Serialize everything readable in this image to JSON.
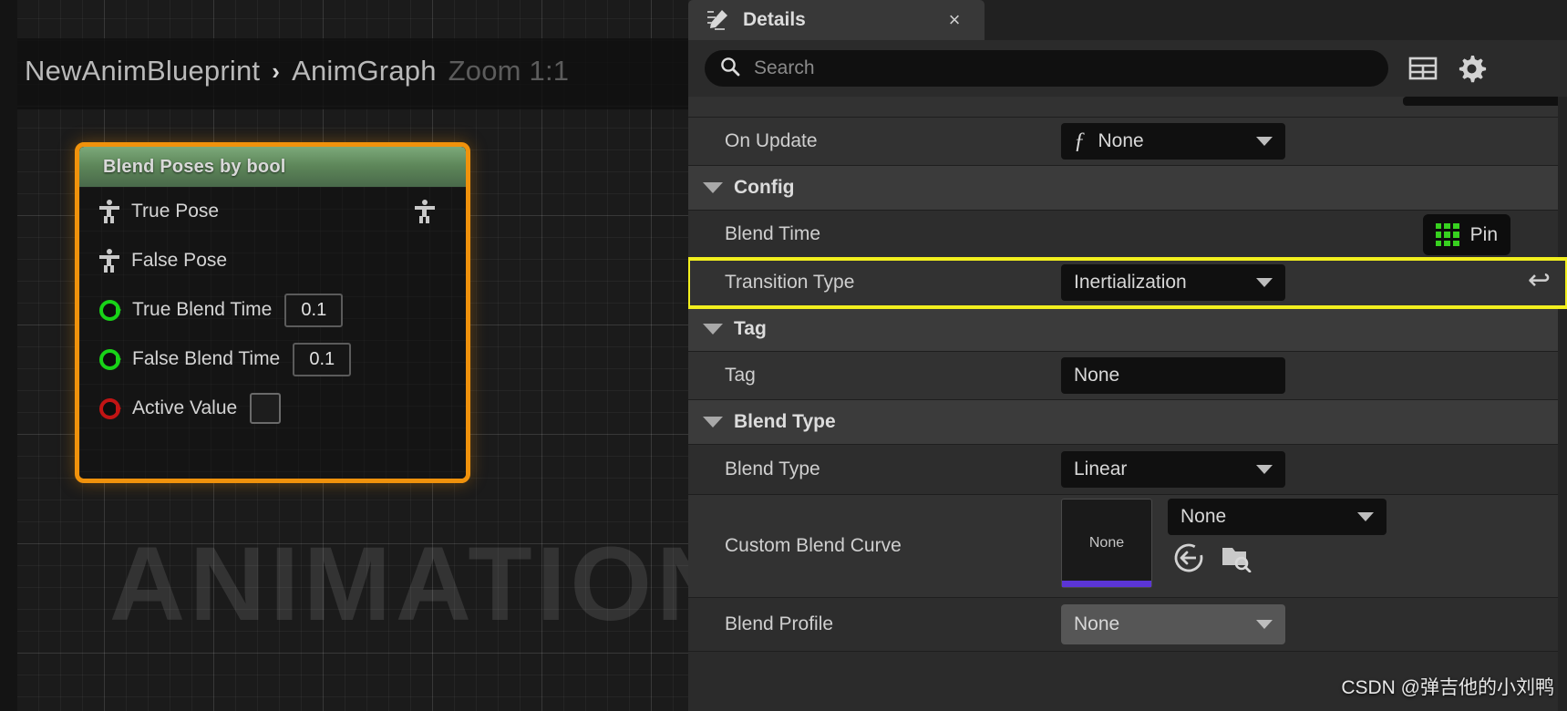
{
  "graph": {
    "breadcrumb": {
      "root": "NewAnimBlueprint",
      "separator": "›",
      "current": "AnimGraph"
    },
    "zoom_label": "Zoom 1:1",
    "background_watermark": "ANIMATION",
    "node": {
      "title": "Blend Poses by bool",
      "pins": [
        {
          "name": "True Pose",
          "icon": "pose-icon",
          "type": "pose",
          "value": null
        },
        {
          "name": "False Pose",
          "icon": "pose-icon",
          "type": "pose",
          "value": null
        },
        {
          "name": "True Blend Time",
          "icon": "float-pin",
          "type": "float",
          "value": "0.1"
        },
        {
          "name": "False Blend Time",
          "icon": "float-pin",
          "type": "float",
          "value": "0.1"
        },
        {
          "name": "Active Value",
          "icon": "bool-pin",
          "type": "bool",
          "value": ""
        }
      ],
      "output_pin": {
        "name": "",
        "icon": "pose-icon"
      },
      "colors": {
        "selection": "#f0920c",
        "header_green": "#5d8659",
        "float_pin": "#18d318",
        "bool_pin": "#c11414"
      }
    }
  },
  "panel": {
    "tab": {
      "title": "Details",
      "icon": "details-pencil-icon",
      "close": "×"
    },
    "search": {
      "placeholder": "Search",
      "icon": "search-icon"
    },
    "toolbar": [
      {
        "name": "column-view-icon",
        "label": ""
      },
      {
        "name": "settings-gear-icon",
        "label": ""
      }
    ],
    "rows": [
      {
        "kind": "prop",
        "label": "On Update",
        "control": "function",
        "value": "None",
        "fn_glyph": "ƒ"
      },
      {
        "kind": "section",
        "label": "Config"
      },
      {
        "kind": "prop",
        "label": "Blend Time",
        "control": "pin",
        "value": "Pin"
      },
      {
        "kind": "prop",
        "label": "Transition Type",
        "control": "combo",
        "value": "Inertialization",
        "highlighted": true,
        "revert": "↩"
      },
      {
        "kind": "section",
        "label": "Tag"
      },
      {
        "kind": "prop",
        "label": "Tag",
        "control": "text",
        "value": "None"
      },
      {
        "kind": "section",
        "label": "Blend Type"
      },
      {
        "kind": "prop",
        "label": "Blend Type",
        "control": "combo",
        "value": "Linear"
      },
      {
        "kind": "prop",
        "label": "Custom Blend Curve",
        "control": "asset",
        "value": "None",
        "thumb": "None"
      },
      {
        "kind": "prop",
        "label": "Blend Profile",
        "control": "combo",
        "value": "None",
        "hovered": true
      }
    ],
    "colors": {
      "highlight": "#f2ef1e",
      "pin_green": "#37d11f",
      "thumb_accent": "#5b35d6"
    }
  },
  "watermark": "CSDN @弹吉他的小刘鸭"
}
